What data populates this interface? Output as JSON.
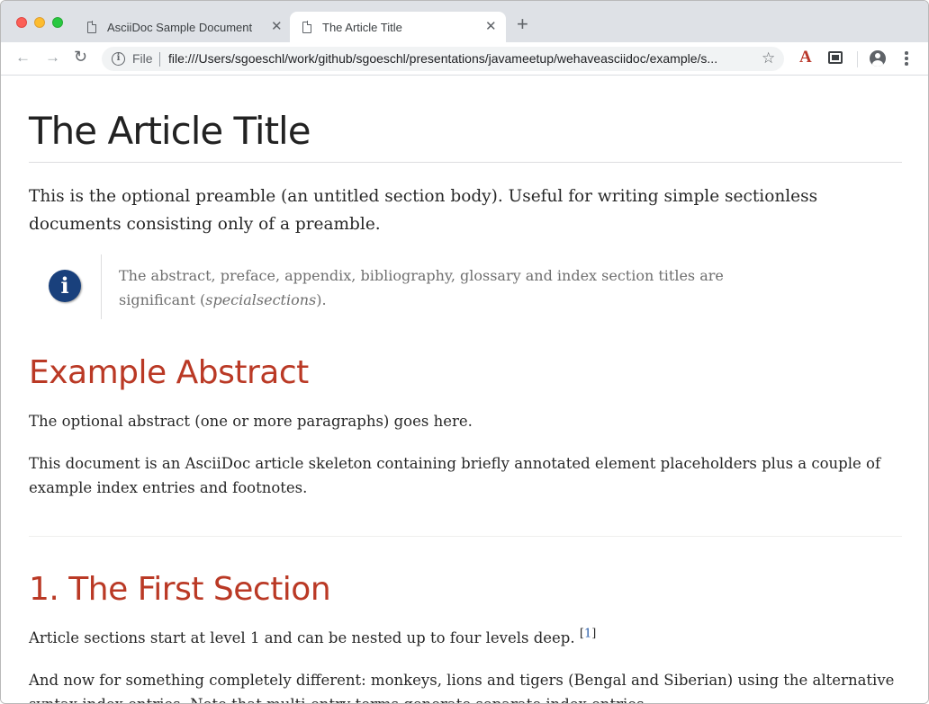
{
  "browser": {
    "tabs": [
      {
        "title": "AsciiDoc Sample Document",
        "active": false
      },
      {
        "title": "The Article Title",
        "active": true
      }
    ],
    "new_tab_glyph": "+",
    "close_glyph": "✕",
    "toolbar": {
      "back_glyph": "←",
      "forward_glyph": "→",
      "reload_glyph": "↻",
      "security_label": "File",
      "url": "file:///Users/sgoeschl/work/github/sgoeschl/presentations/javameetup/wehaveasciidoc/example/s...",
      "star_glyph": "☆",
      "extension_glyph": "A"
    }
  },
  "document": {
    "title": "The Article Title",
    "preamble": "This is the optional preamble (an untitled section body). Useful for writing simple sectionless documents consisting only of a preamble.",
    "admonition": {
      "icon": "info-icon",
      "icon_glyph": "i",
      "text_before": "The abstract, preface, appendix, bibliography, glossary and index section titles are significant (",
      "text_emphasis": "specialsections",
      "text_after": ")."
    },
    "sections": [
      {
        "title": "Example Abstract",
        "paragraphs": [
          "The optional abstract (one or more paragraphs) goes here.",
          "This document is an AsciiDoc article skeleton containing briefly annotated element placeholders plus a couple of example index entries and footnotes."
        ]
      },
      {
        "title": "1. The First Section",
        "paragraphs": [
          "Article sections start at level 1 and can be nested up to four levels deep.",
          "And now for something completely different: monkeys, lions and tigers (Bengal and Siberian) using the alternative syntax index entries. Note that multi-entry terms generate separate index entries."
        ],
        "footnote_ref": "1"
      }
    ]
  },
  "colors": {
    "heading": "#ba3925",
    "admonition_icon": "#19407c",
    "link": "#2156a5"
  }
}
